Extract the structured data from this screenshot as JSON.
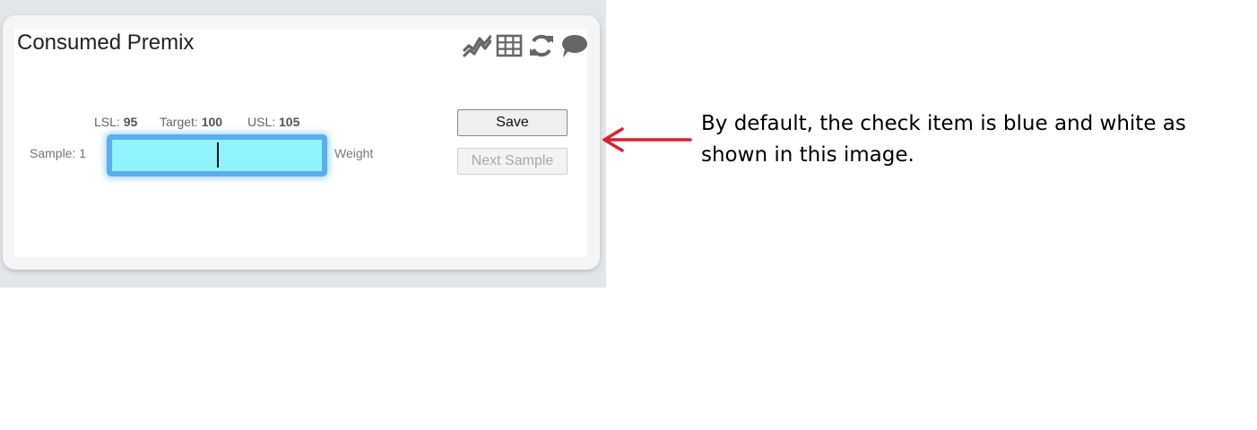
{
  "card": {
    "title": "Consumed Premix",
    "toolbar": [
      {
        "icon": "chart-line-icon"
      },
      {
        "icon": "table-icon"
      },
      {
        "icon": "refresh-icon"
      },
      {
        "icon": "comment-icon"
      }
    ],
    "specs": {
      "lsl_label": "LSL:",
      "lsl_value": "95",
      "target_label": "Target:",
      "target_value": "100",
      "usl_label": "USL:",
      "usl_value": "105"
    },
    "sample_label": "Sample: 1",
    "measurement_label": "Weight",
    "input": {
      "value": "",
      "placeholder": ""
    },
    "buttons": {
      "save": "Save",
      "next_sample": "Next Sample"
    },
    "colors": {
      "input_fill": "#90f3fe",
      "input_border": "#5aaeee",
      "arrow": "#d62230"
    }
  },
  "annotation": {
    "text": "By default, the check item is blue and white as shown in this image."
  }
}
